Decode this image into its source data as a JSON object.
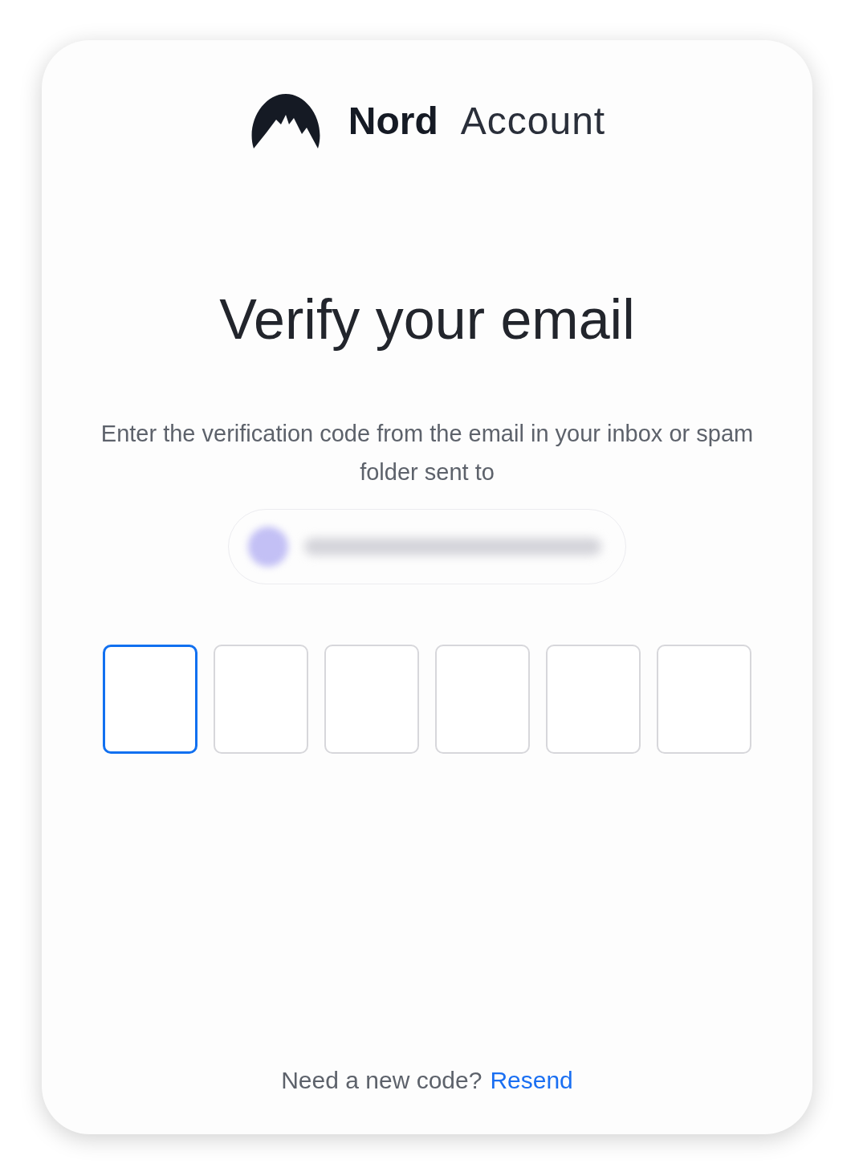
{
  "brand": {
    "name": "Nord",
    "product": "Account"
  },
  "title": "Verify your email",
  "instructions": "Enter the verification code from the email in your inbox or spam folder sent to",
  "code_boxes": [
    {
      "selected": true
    },
    {
      "selected": false
    },
    {
      "selected": false
    },
    {
      "selected": false
    },
    {
      "selected": false
    },
    {
      "selected": false
    }
  ],
  "footer": {
    "prompt": "Need a new code?",
    "link": "Resend"
  }
}
